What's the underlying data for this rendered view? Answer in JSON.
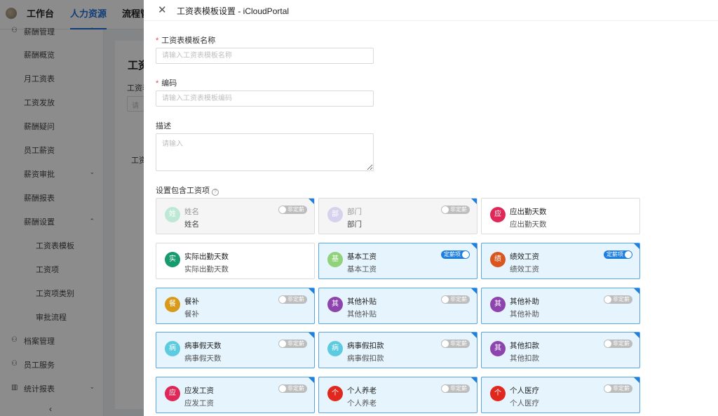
{
  "background_app": {
    "top_nav": [
      "工作台",
      "人力资源",
      "流程管"
    ],
    "active_nav_index": 1,
    "sidebar": {
      "section_top": "薪酬管理",
      "items": [
        "薪酬概览",
        "月工资表",
        "工资发放",
        "薪酬疑问",
        "员工薪资",
        "薪资审批",
        "薪酬报表",
        "薪酬设置"
      ],
      "sub_items": [
        "工资表模板",
        "工资项",
        "工资项类别",
        "审批流程"
      ],
      "groups": [
        "档案管理",
        "员工服务",
        "统计报表"
      ],
      "collapse_icon": "chevron-left-icon"
    },
    "main": {
      "title": "工资",
      "field_label": "工资表",
      "input_placeholder": "请",
      "column": "工资"
    }
  },
  "drawer": {
    "title": "工资表模板设置 - iCloudPortal",
    "close_icon": "close-icon",
    "fields": {
      "name": {
        "label": "工资表模板名称",
        "required": true,
        "placeholder": "请输入工资表模板名称",
        "value": ""
      },
      "code": {
        "label": "编码",
        "required": true,
        "placeholder": "请输入工资表模板编码",
        "value": ""
      },
      "desc": {
        "label": "描述",
        "required": false,
        "placeholder": "请输入",
        "value": ""
      }
    },
    "items_section_label": "设置包含工资项",
    "toggle_on_label": "定薪项",
    "toggle_off_label": "非定薪",
    "accent_color": "#1e7fe0",
    "cards": [
      {
        "char": "姓",
        "name": "姓名",
        "sub": "姓名",
        "color": "#bde8d6",
        "state": "disabled",
        "toggle": "off"
      },
      {
        "char": "部",
        "name": "部门",
        "sub": "部门",
        "color": "#d6d2ee",
        "state": "disabled",
        "toggle": "off"
      },
      {
        "char": "应",
        "name": "应出勤天数",
        "sub": "应出勤天数",
        "color": "#e02858",
        "state": "normal",
        "toggle": "none"
      },
      {
        "char": "实",
        "name": "实际出勤天数",
        "sub": "实际出勤天数",
        "color": "#169a6e",
        "state": "normal",
        "toggle": "none"
      },
      {
        "char": "基",
        "name": "基本工资",
        "sub": "基本工资",
        "color": "#8fd27a",
        "state": "selected",
        "toggle": "on"
      },
      {
        "char": "绩",
        "name": "绩效工资",
        "sub": "绩效工资",
        "color": "#d9571f",
        "state": "selected",
        "toggle": "on"
      },
      {
        "char": "餐",
        "name": "餐补",
        "sub": "餐补",
        "color": "#d99a1a",
        "state": "selected",
        "toggle": "off"
      },
      {
        "char": "其",
        "name": "其他补贴",
        "sub": "其他补贴",
        "color": "#8e44ad",
        "state": "selected",
        "toggle": "off"
      },
      {
        "char": "其",
        "name": "其他补助",
        "sub": "其他补助",
        "color": "#8e44ad",
        "state": "selected",
        "toggle": "off"
      },
      {
        "char": "病",
        "name": "病事假天数",
        "sub": "病事假天数",
        "color": "#5ccbe0",
        "state": "selected",
        "toggle": "off"
      },
      {
        "char": "病",
        "name": "病事假扣款",
        "sub": "病事假扣款",
        "color": "#5ccbe0",
        "state": "selected",
        "toggle": "off"
      },
      {
        "char": "其",
        "name": "其他扣款",
        "sub": "其他扣款",
        "color": "#8e44ad",
        "state": "selected",
        "toggle": "off"
      },
      {
        "char": "应",
        "name": "应发工资",
        "sub": "应发工资",
        "color": "#e02858",
        "state": "selected",
        "toggle": "off"
      },
      {
        "char": "个",
        "name": "个人养老",
        "sub": "个人养老",
        "color": "#e0281f",
        "state": "selected",
        "toggle": "off"
      },
      {
        "char": "个",
        "name": "个人医疗",
        "sub": "个人医疗",
        "color": "#e0281f",
        "state": "selected",
        "toggle": "off"
      }
    ]
  }
}
